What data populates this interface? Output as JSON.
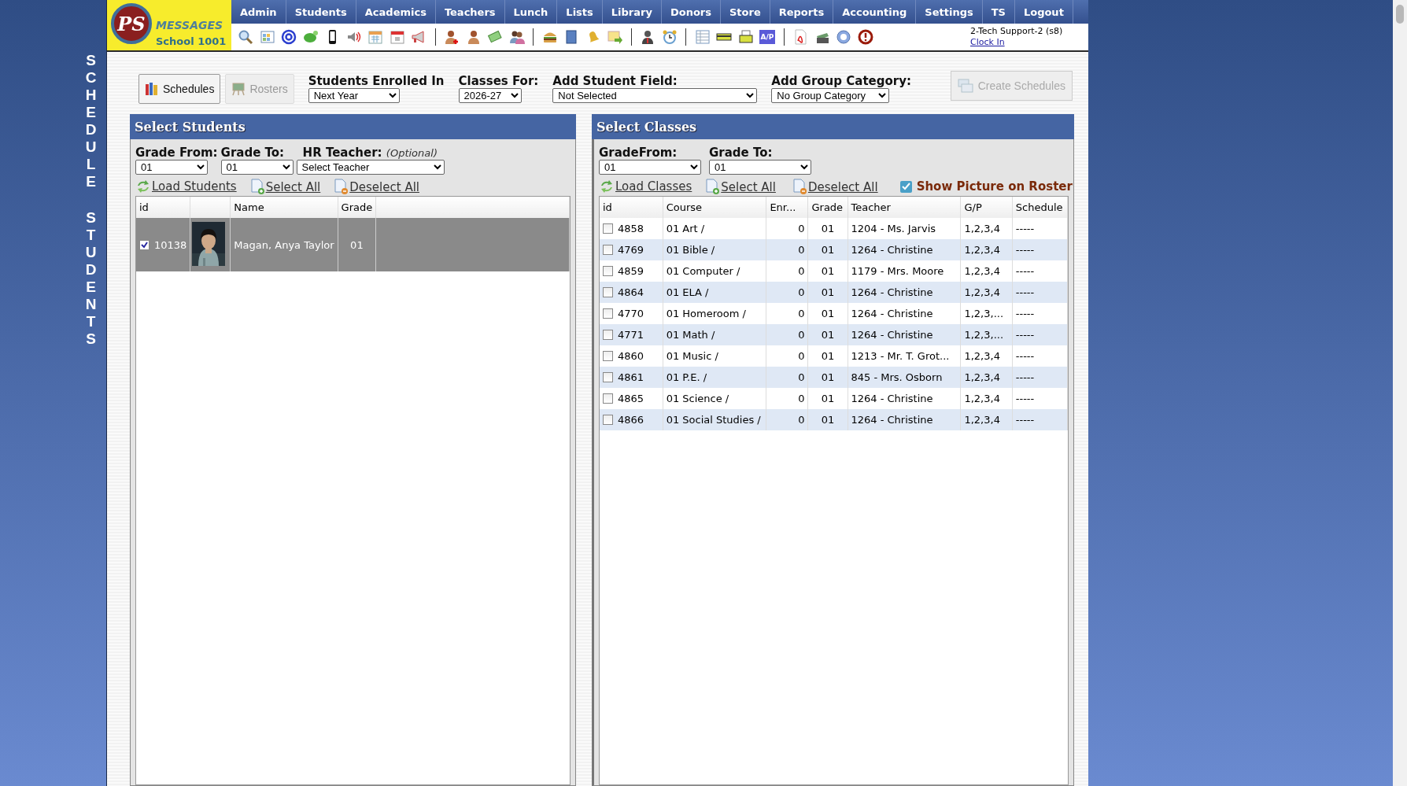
{
  "side_title": [
    "SCHEDULE",
    "STUDENTS"
  ],
  "logo": {
    "mark": "PS",
    "name": "MESSAGES",
    "school": "School 1001"
  },
  "nav": [
    {
      "label": "Admin"
    },
    {
      "label": "Students"
    },
    {
      "label": "Academics"
    },
    {
      "label": "Teachers"
    },
    {
      "label": "Lunch"
    },
    {
      "label": "Lists"
    },
    {
      "label": "Library"
    },
    {
      "label": "Donors"
    },
    {
      "label": "Store"
    },
    {
      "label": "Reports"
    },
    {
      "label": "Accounting"
    },
    {
      "label": "Settings"
    },
    {
      "label": "TS"
    },
    {
      "label": "Logout"
    }
  ],
  "toolbar": {
    "ap_label": "A/P"
  },
  "user": {
    "name": "2-Tech Support-2 (s8)",
    "link": "Clock In"
  },
  "controls": {
    "buttons": [
      {
        "kind": "schedules",
        "label": "Schedules",
        "disabled": false
      },
      {
        "kind": "rosters",
        "label": "Rosters",
        "disabled": true
      }
    ],
    "fields": [
      {
        "label": "Students Enrolled In",
        "value": "Next Year"
      },
      {
        "label": "Classes For:",
        "value": "2026-27"
      },
      {
        "label": "Add Student Field:",
        "value": "Not Selected"
      },
      {
        "label": "Add Group Category:",
        "value": "No Group Category"
      }
    ],
    "create": {
      "label": "Create Schedules",
      "disabled": true
    }
  },
  "students": {
    "title": "Select Students",
    "filters": [
      {
        "label": "Grade From:",
        "value": "01"
      },
      {
        "label": "Grade To:",
        "value": "01"
      },
      {
        "label": "HR Teacher:",
        "hint": "(Optional)",
        "value": "Select Teacher"
      }
    ],
    "links": [
      {
        "kind": "load",
        "label": "Load Students"
      },
      {
        "kind": "select",
        "label": "Select All"
      },
      {
        "kind": "deselect",
        "label": "Deselect All"
      }
    ],
    "columns": [
      "id",
      "",
      "Name",
      "Grade"
    ],
    "rows": [
      {
        "id": "10138",
        "name": "Magan, Anya Taylor",
        "grade": "01",
        "checked": true,
        "selected": true
      }
    ]
  },
  "classes": {
    "title": "Select Classes",
    "filters": [
      {
        "label": "GradeFrom:",
        "value": "01"
      },
      {
        "label": "Grade To:",
        "value": "01"
      }
    ],
    "links": [
      {
        "kind": "load",
        "label": "Load Classes"
      },
      {
        "kind": "select",
        "label": "Select All"
      },
      {
        "kind": "deselect",
        "label": "Deselect All"
      }
    ],
    "show_picture": {
      "label": "Show Picture on Roster",
      "checked": true
    },
    "columns": [
      "id",
      "Course",
      "Enr...",
      "Grade",
      "Teacher",
      "G/P",
      "Schedule"
    ],
    "rows": [
      {
        "id": "4858",
        "course": "01 Art /",
        "enrolled": "0",
        "grade": "01",
        "teacher": "1204 - Ms. Jarvis",
        "gp": "1,2,3,4",
        "schedule": "-----",
        "checked": false
      },
      {
        "id": "4769",
        "course": "01 Bible /",
        "enrolled": "0",
        "grade": "01",
        "teacher": "1264 - Christine",
        "gp": "1,2,3,4",
        "schedule": "-----",
        "checked": false
      },
      {
        "id": "4859",
        "course": "01 Computer /",
        "enrolled": "0",
        "grade": "01",
        "teacher": "1179 - Mrs. Moore",
        "gp": "1,2,3,4",
        "schedule": "-----",
        "checked": false
      },
      {
        "id": "4864",
        "course": "01 ELA /",
        "enrolled": "0",
        "grade": "01",
        "teacher": "1264 - Christine",
        "gp": "1,2,3,4",
        "schedule": "-----",
        "checked": false
      },
      {
        "id": "4770",
        "course": "01 Homeroom /",
        "enrolled": "0",
        "grade": "01",
        "teacher": "1264 - Christine",
        "gp": "1,2,3,...",
        "schedule": "-----",
        "checked": false
      },
      {
        "id": "4771",
        "course": "01 Math /",
        "enrolled": "0",
        "grade": "01",
        "teacher": "1264 - Christine",
        "gp": "1,2,3,...",
        "schedule": "-----",
        "checked": false
      },
      {
        "id": "4860",
        "course": "01 Music /",
        "enrolled": "0",
        "grade": "01",
        "teacher": "1213 - Mr. T. Grot...",
        "gp": "1,2,3,4",
        "schedule": "-----",
        "checked": false
      },
      {
        "id": "4861",
        "course": "01 P.E. /",
        "enrolled": "0",
        "grade": "01",
        "teacher": "845 - Mrs. Osborn",
        "gp": "1,2,3,4",
        "schedule": "-----",
        "checked": false
      },
      {
        "id": "4865",
        "course": "01 Science /",
        "enrolled": "0",
        "grade": "01",
        "teacher": "1264 - Christine",
        "gp": "1,2,3,4",
        "schedule": "-----",
        "checked": false
      },
      {
        "id": "4866",
        "course": "01 Social Studies /",
        "enrolled": "0",
        "grade": "01",
        "teacher": "1264 - Christine",
        "gp": "1,2,3,4",
        "schedule": "-----",
        "checked": false
      }
    ]
  }
}
